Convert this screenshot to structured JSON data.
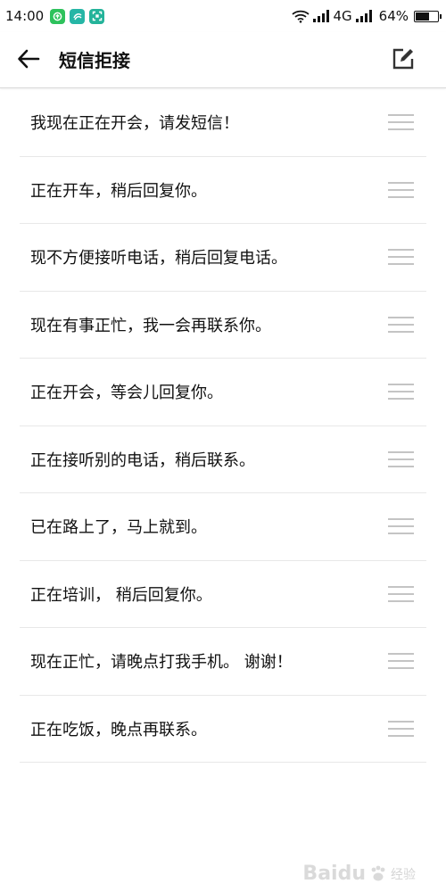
{
  "status_bar": {
    "time": "14:00",
    "network": "4G",
    "battery_text": "64%",
    "battery_level": 0.64,
    "app_icons": [
      {
        "name": "app-green-icon",
        "color": "#2ec25c"
      },
      {
        "name": "app-teal-icon",
        "color": "#26b6a6"
      },
      {
        "name": "app-scan-icon",
        "color": "#24b39a"
      }
    ]
  },
  "header": {
    "title": "短信拒接",
    "back_icon": "arrow-left-icon",
    "edit_icon": "edit-icon"
  },
  "replies": [
    {
      "text": "我现在正在开会，请发短信！"
    },
    {
      "text": "正在开车，稍后回复你。"
    },
    {
      "text": "现不方便接听电话，稍后回复电话。"
    },
    {
      "text": "现在有事正忙，我一会再联系你。"
    },
    {
      "text": "正在开会，等会儿回复你。"
    },
    {
      "text": "正在接听别的电话，稍后联系。"
    },
    {
      "text": "已在路上了，马上就到。"
    },
    {
      "text": "正在培训， 稍后回复你。"
    },
    {
      "text": "现在正忙，请晚点打我手机。 谢谢！"
    },
    {
      "text": "正在吃饭，晚点再联系。"
    }
  ],
  "colors": {
    "divider": "#e8e8e8",
    "handle": "#c4c4c4",
    "text": "#111111"
  },
  "watermark": {
    "brand": "Baidu",
    "suffix": "经验"
  }
}
